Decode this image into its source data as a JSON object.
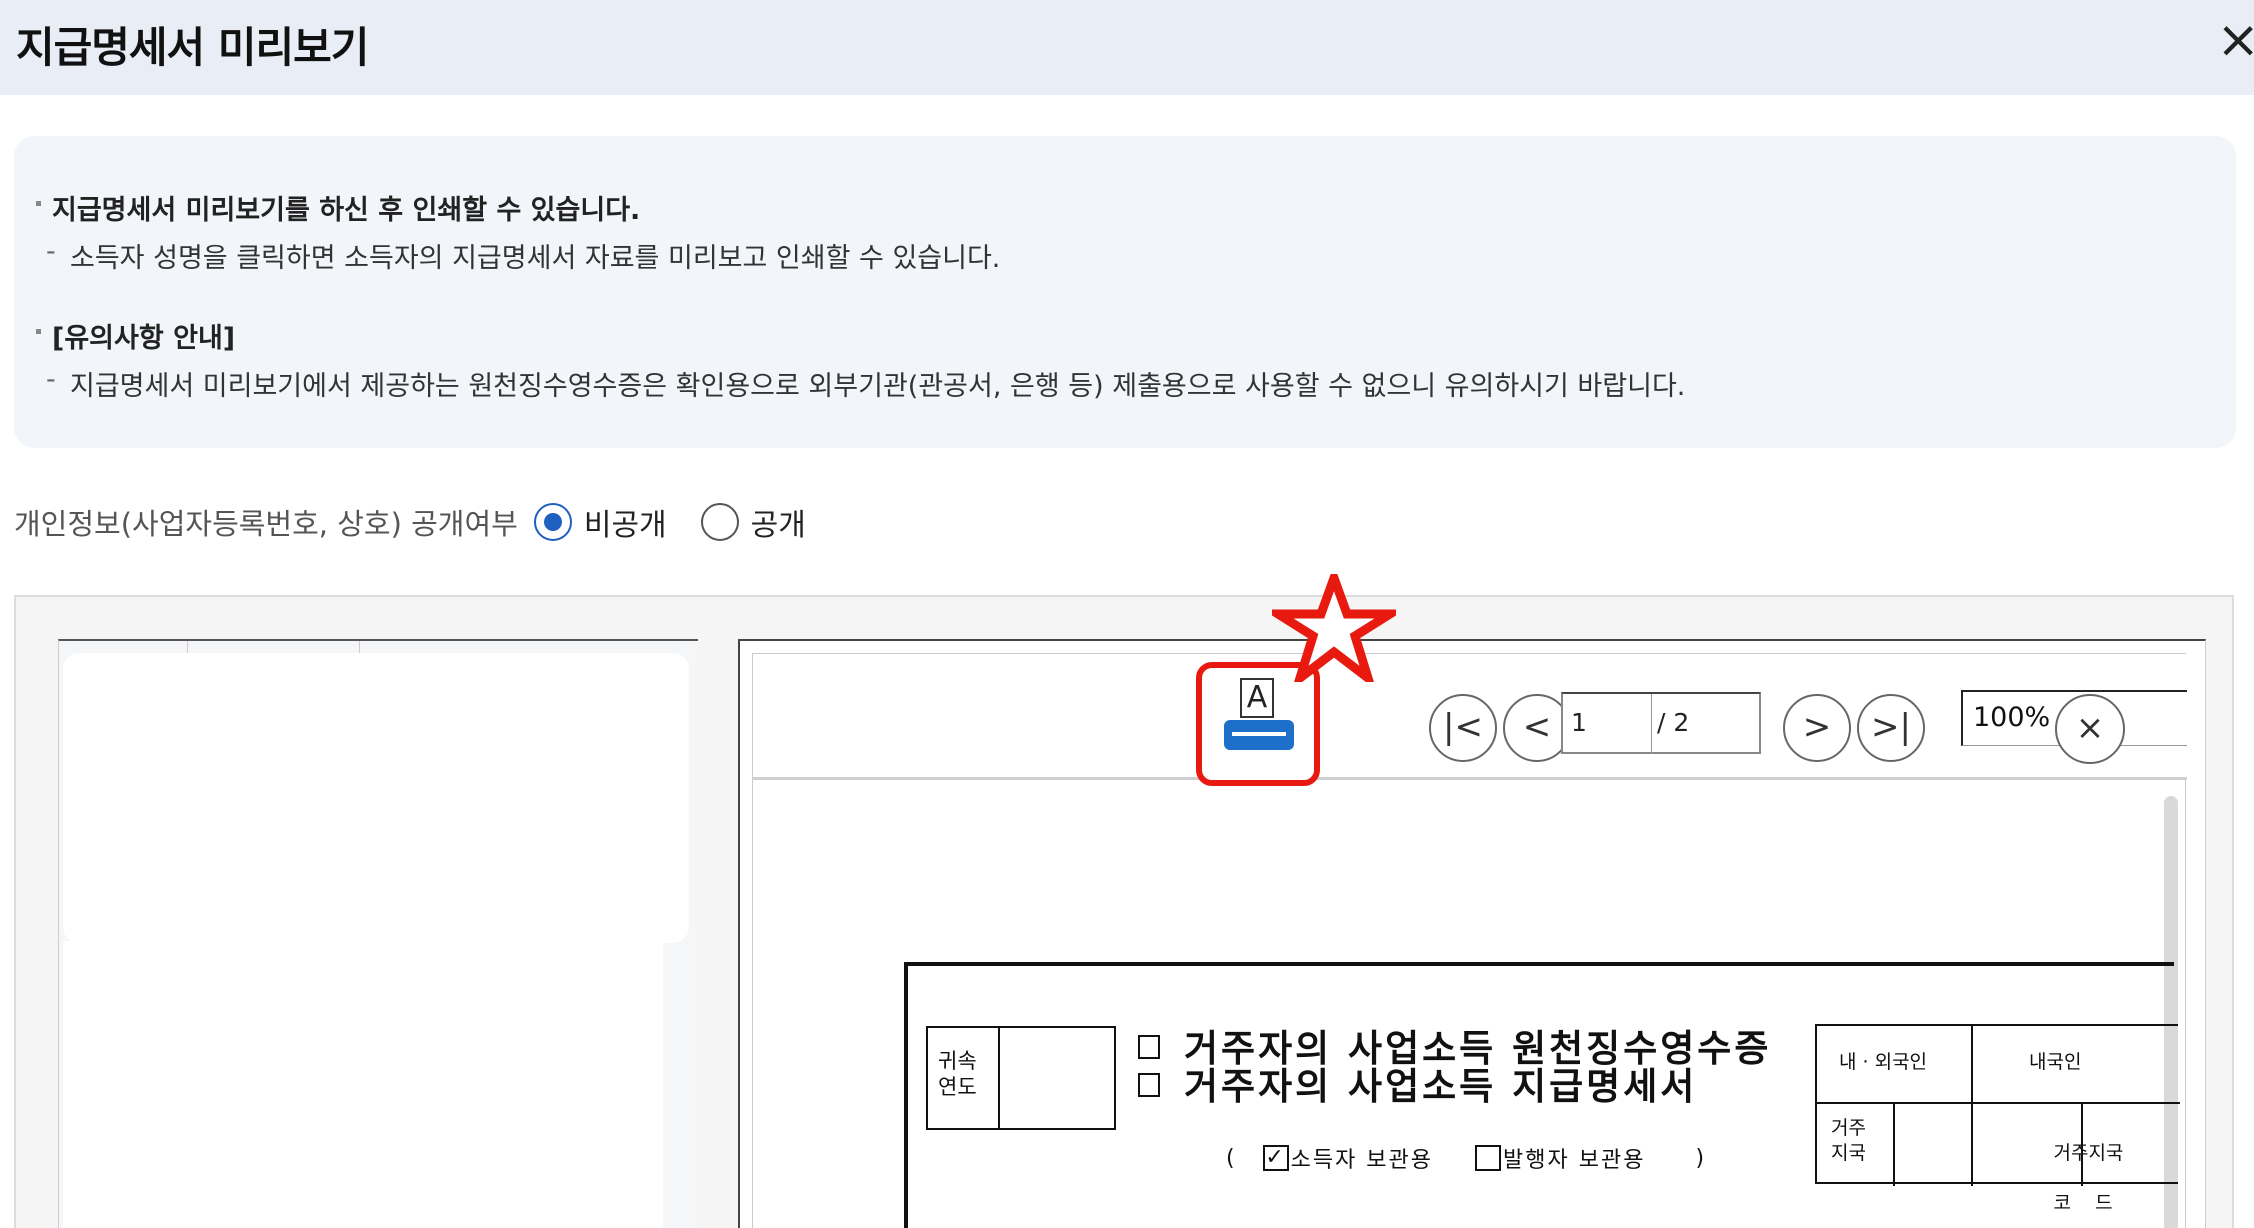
{
  "modal": {
    "title": "지급명세서 미리보기",
    "close_icon": "×"
  },
  "notice": {
    "item1": "지급명세서 미리보기를 하신 후 인쇄할 수 있습니다.",
    "item1_sub": "소득자 성명을 클릭하면 소득자의 지급명세서 자료를 미리보고 인쇄할 수 있습니다.",
    "item2": "[유의사항 안내]",
    "item2_sub": "지급명세서 미리보기에서 제공하는 원천징수영수증은 확인용으로 외부기관(관공서, 은행 등) 제출용으로 사용할 수 없으니 유의하시기 바랍니다."
  },
  "privacy": {
    "label": "개인정보(사업자등록번호, 상호) 공개여부",
    "options": [
      "비공개",
      "공개"
    ],
    "selected": "비공개"
  },
  "viewer": {
    "print_icon_letter": "A",
    "first_icon": "|<",
    "prev_icon": "<",
    "next_icon": ">",
    "last_icon": ">|",
    "page_current": "1",
    "page_total": "/ 2",
    "zoom": "100%",
    "zoom_clear_icon": "×",
    "print_icon_color": "#1d6fc9",
    "highlight_color": "#e8190e"
  },
  "document": {
    "year_label_1": "귀속",
    "year_label_2": "연도",
    "title_line1": "거주자의 사업소득 원천징수영수증",
    "title_line2": "거주자의 사업소득 지급명세서",
    "copy_open": "(",
    "copy_earner": "소득자 보관용",
    "copy_payer": "발행자 보관용",
    "copy_close": ")",
    "nationality_label": "내 · 외국인",
    "nationality_value": "내국인",
    "residence_country_1": "거주",
    "residence_country_2": "지국",
    "residence_code_1": "거주지국",
    "residence_code_2": "코    드"
  }
}
